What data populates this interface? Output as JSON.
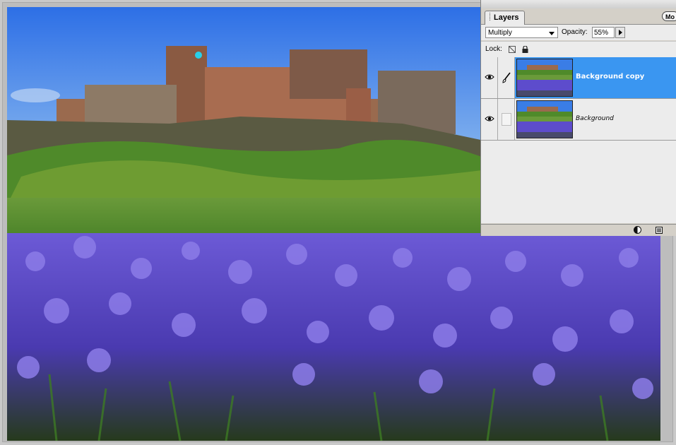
{
  "palette": {
    "tab_label": "Layers",
    "more_label": "Mo",
    "blend_mode": "Multiply",
    "opacity_label": "Opacity:",
    "opacity_value": "55%",
    "lock_label": "Lock:"
  },
  "layers": [
    {
      "name": "Background copy",
      "visible": true,
      "selected": true
    },
    {
      "name": "Background",
      "visible": true,
      "selected": false
    }
  ],
  "icons": {
    "eye": "eye-icon",
    "brush": "paintbrush-icon",
    "lock_transparency": "lock-transparency-icon",
    "lock_all": "padlock-icon",
    "adjustment": "adjustment-layer-icon",
    "new_layer": "new-layer-icon"
  },
  "colors": {
    "selection": "#3a96f1",
    "panel": "#d4d0c8"
  }
}
